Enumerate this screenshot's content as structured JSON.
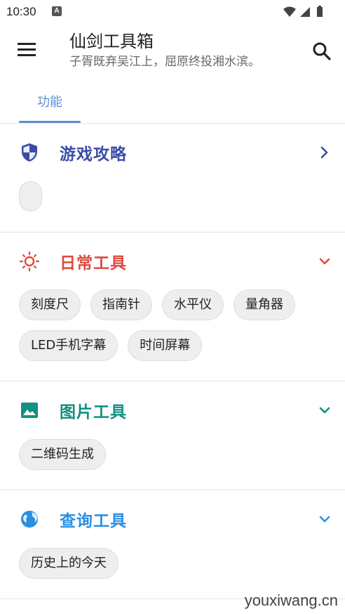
{
  "status_bar": {
    "time": "10:30",
    "notification_icon": "A"
  },
  "app_bar": {
    "title": "仙剑工具箱",
    "subtitle": "子胥既弃吴江上，屈原终投湘水滨。",
    "menu_icon": "hamburger-menu-icon",
    "search_icon": "search-icon"
  },
  "tabs": [
    {
      "label": "功能",
      "selected": true
    }
  ],
  "colors": {
    "accent": "#5b8fd6",
    "game": "#3a4da6",
    "daily": "#e04a3f",
    "image": "#129080",
    "query": "#2b8fe0"
  },
  "sections": [
    {
      "title": "游戏攻略",
      "icon": "shield-icon",
      "chevron": "chevron-right-icon",
      "chips": []
    },
    {
      "title": "日常工具",
      "icon": "sun-icon",
      "chevron": "chevron-down-icon",
      "chips": [
        "刻度尺",
        "指南针",
        "水平仪",
        "量角器",
        "LED手机字幕",
        "时间屏幕"
      ]
    },
    {
      "title": "图片工具",
      "icon": "image-icon",
      "chevron": "chevron-down-icon",
      "chips": [
        "二维码生成"
      ]
    },
    {
      "title": "查询工具",
      "icon": "globe-icon",
      "chevron": "chevron-down-icon",
      "chips": [
        "历史上的今天"
      ]
    }
  ],
  "watermark": "youxiwang.cn"
}
